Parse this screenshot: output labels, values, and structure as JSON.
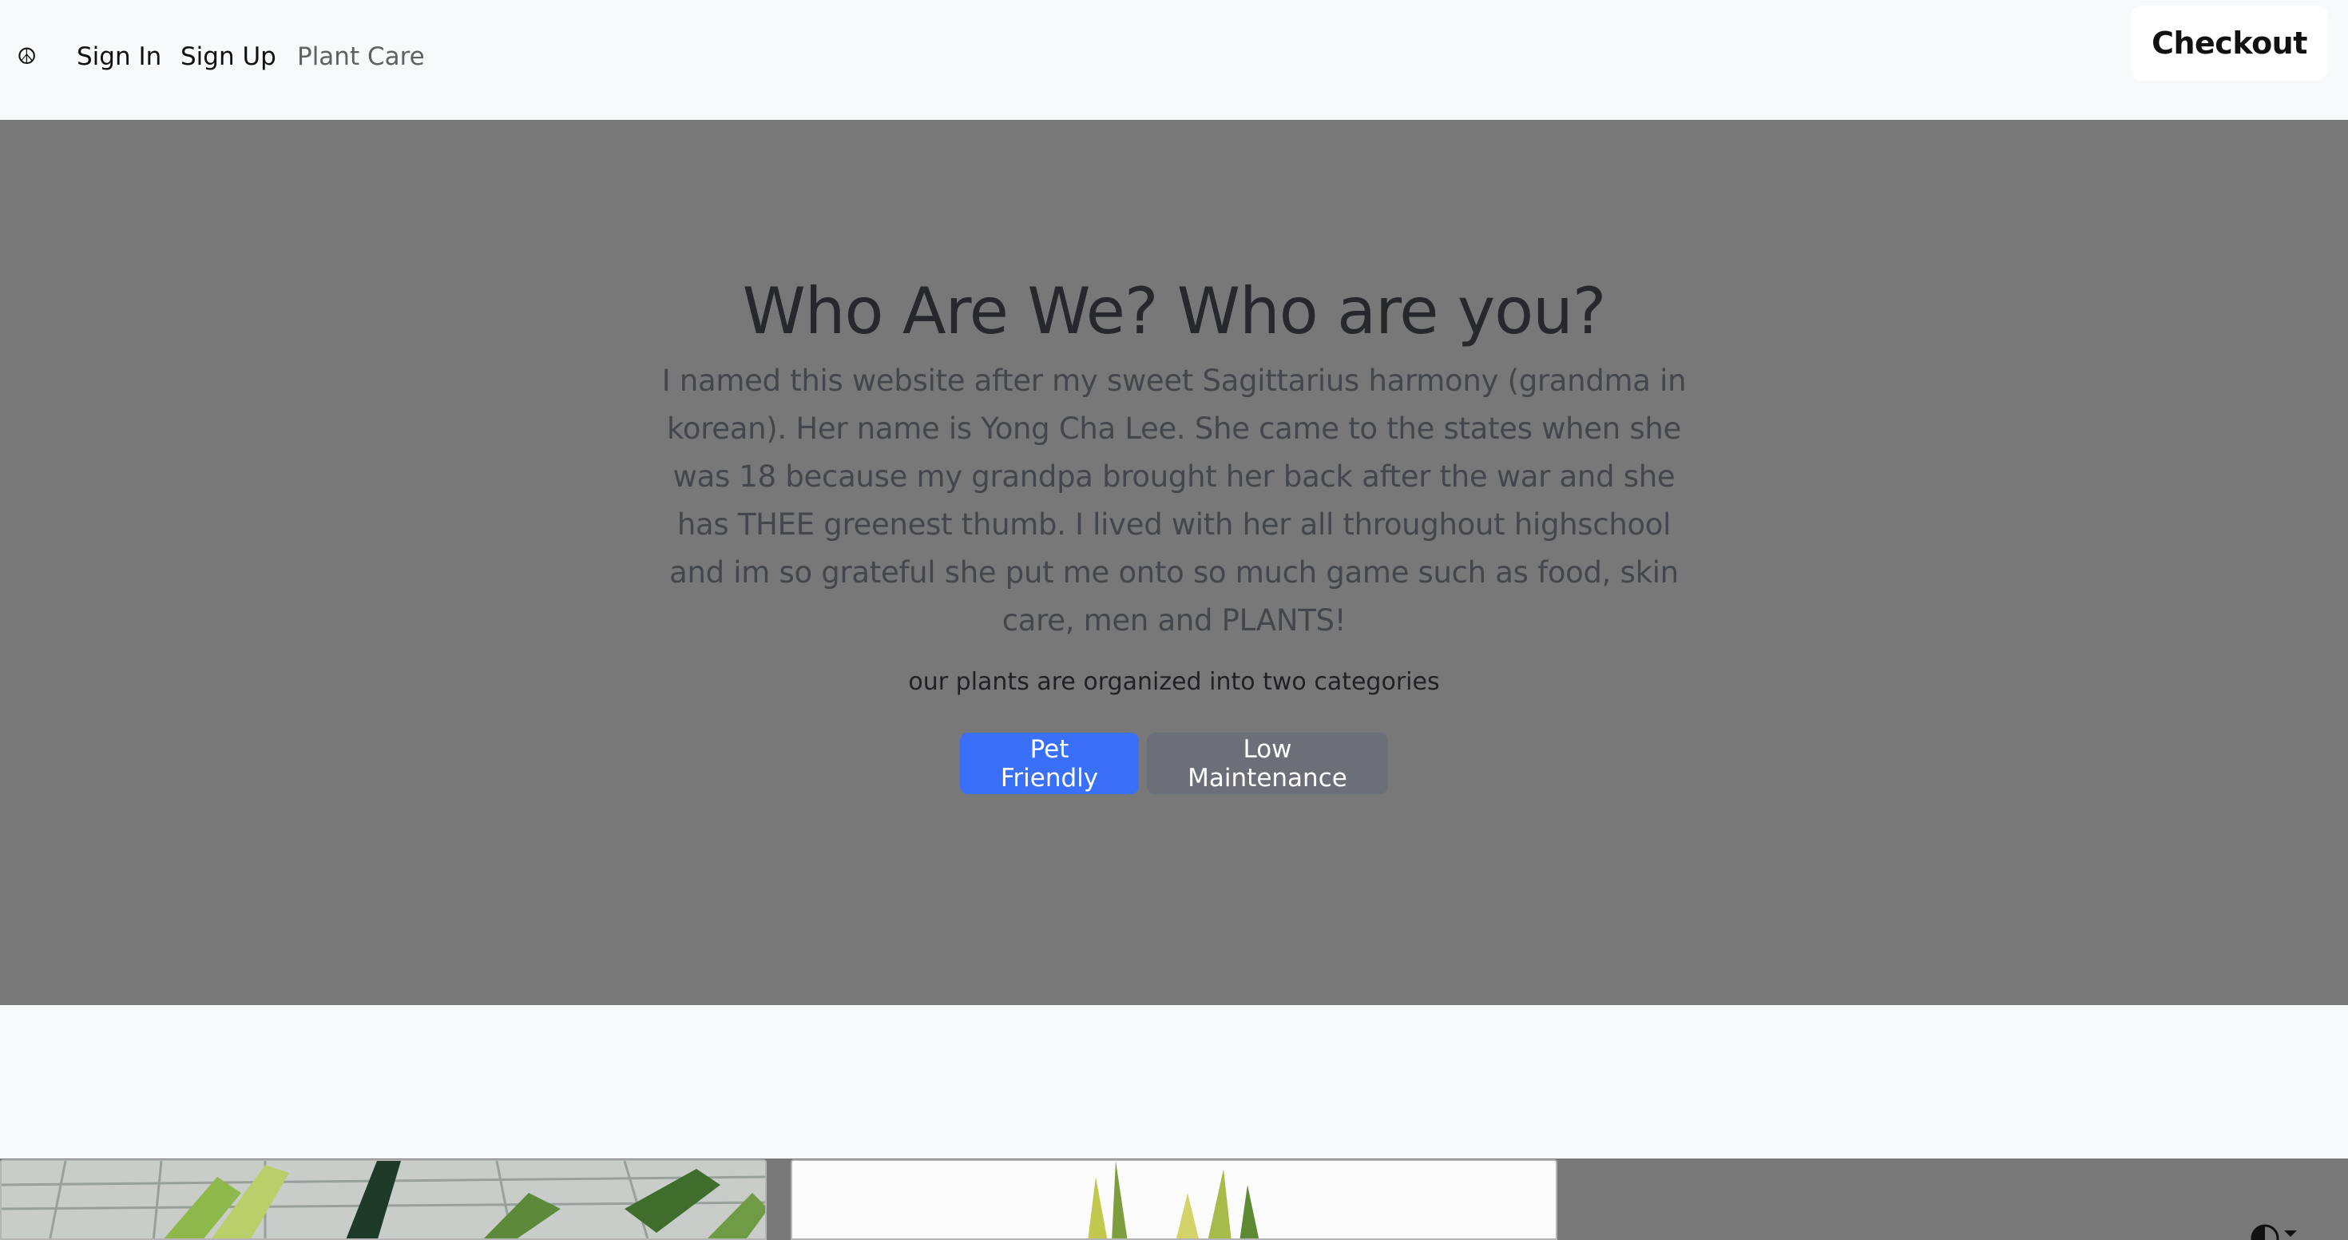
{
  "navbar": {
    "brand_icon": "peace-sign-icon",
    "brand_glyph": "☮",
    "links": {
      "sign_in": "Sign In",
      "sign_up": "Sign Up",
      "plant_care": "Plant Care"
    },
    "checkout_label": "Checkout"
  },
  "hero": {
    "title": "Who Are We? Who are you?",
    "lead": "I named this website after my sweet Sagittarius harmony (grandma in korean). Her name is Yong Cha Lee. She came to the states when she was 18 because my grandpa brought her back after the war and she has THEE greenest thumb. I lived with her all throughout highschool and im so grateful she put me onto so much game such as food, skin care, men and PLANTS!",
    "subtitle": "our plants are organized into two categories",
    "buttons": {
      "pet_friendly": "Pet Friendly",
      "low_maintenance": "Low Maintenance"
    }
  },
  "gallery": {
    "cards": [
      {
        "image": "plant-photo-greenhouse"
      },
      {
        "image": "plant-photo-snake-plant"
      }
    ],
    "theme_toggle_icon": "contrast-half-circle-icon"
  },
  "colors": {
    "primary": "#3a70f8",
    "secondary": "#6b7078",
    "hero_bg": "#787878",
    "page_bg": "#f8f9fa"
  }
}
